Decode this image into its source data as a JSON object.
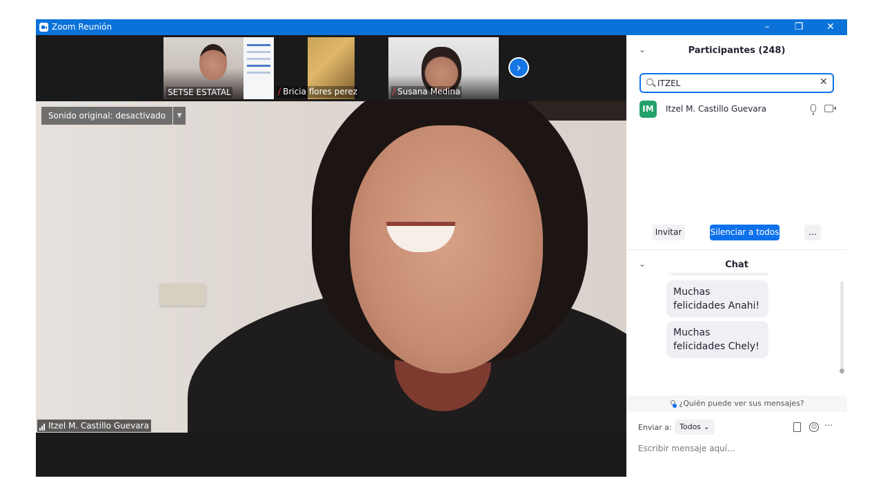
{
  "window": {
    "title": "Zoom Reunión",
    "controls": {
      "minimize": "–",
      "restore": "❐",
      "close": "✕"
    }
  },
  "gallery": {
    "tiles": [
      {
        "name": "SETSE ESTATAL",
        "muted": false
      },
      {
        "name": "Bricia flores perez",
        "muted": true
      },
      {
        "name": "Susana Medina",
        "muted": true
      }
    ],
    "next_glyph": "›"
  },
  "main_video": {
    "original_sound_label": "Sonido original: desactivado",
    "original_sound_dropdown": "▼",
    "speaker_name": "Itzel M. Castillo Guevara"
  },
  "participants": {
    "collapse_glyph": "⌄",
    "title": "Participantes (248)",
    "search_value": "ITZEL",
    "clear_glyph": "✕",
    "list": [
      {
        "initials": "IM",
        "name": "Itzel M. Castillo Guevara",
        "avatar_color": "#23a16a"
      }
    ],
    "invite_label": "Invitar",
    "mute_all_label": "Silenciar a todos",
    "more_label": "..."
  },
  "chat": {
    "collapse_glyph": "⌄",
    "title": "Chat",
    "messages": [
      "Muchas felicidades Anahi!",
      "Muchas felicidades Chely!"
    ],
    "who_can_see": "¿Quién puede ver sus mensajes?",
    "send_to_label": "Enviar a:",
    "send_to_value": "Todos ⌄",
    "more_glyph": "···",
    "message_placeholder": "Escribir mensaje aquí..."
  },
  "colors": {
    "titlebar": "#0b72d9",
    "accent": "#0e71eb",
    "muted": "#e0393e"
  }
}
